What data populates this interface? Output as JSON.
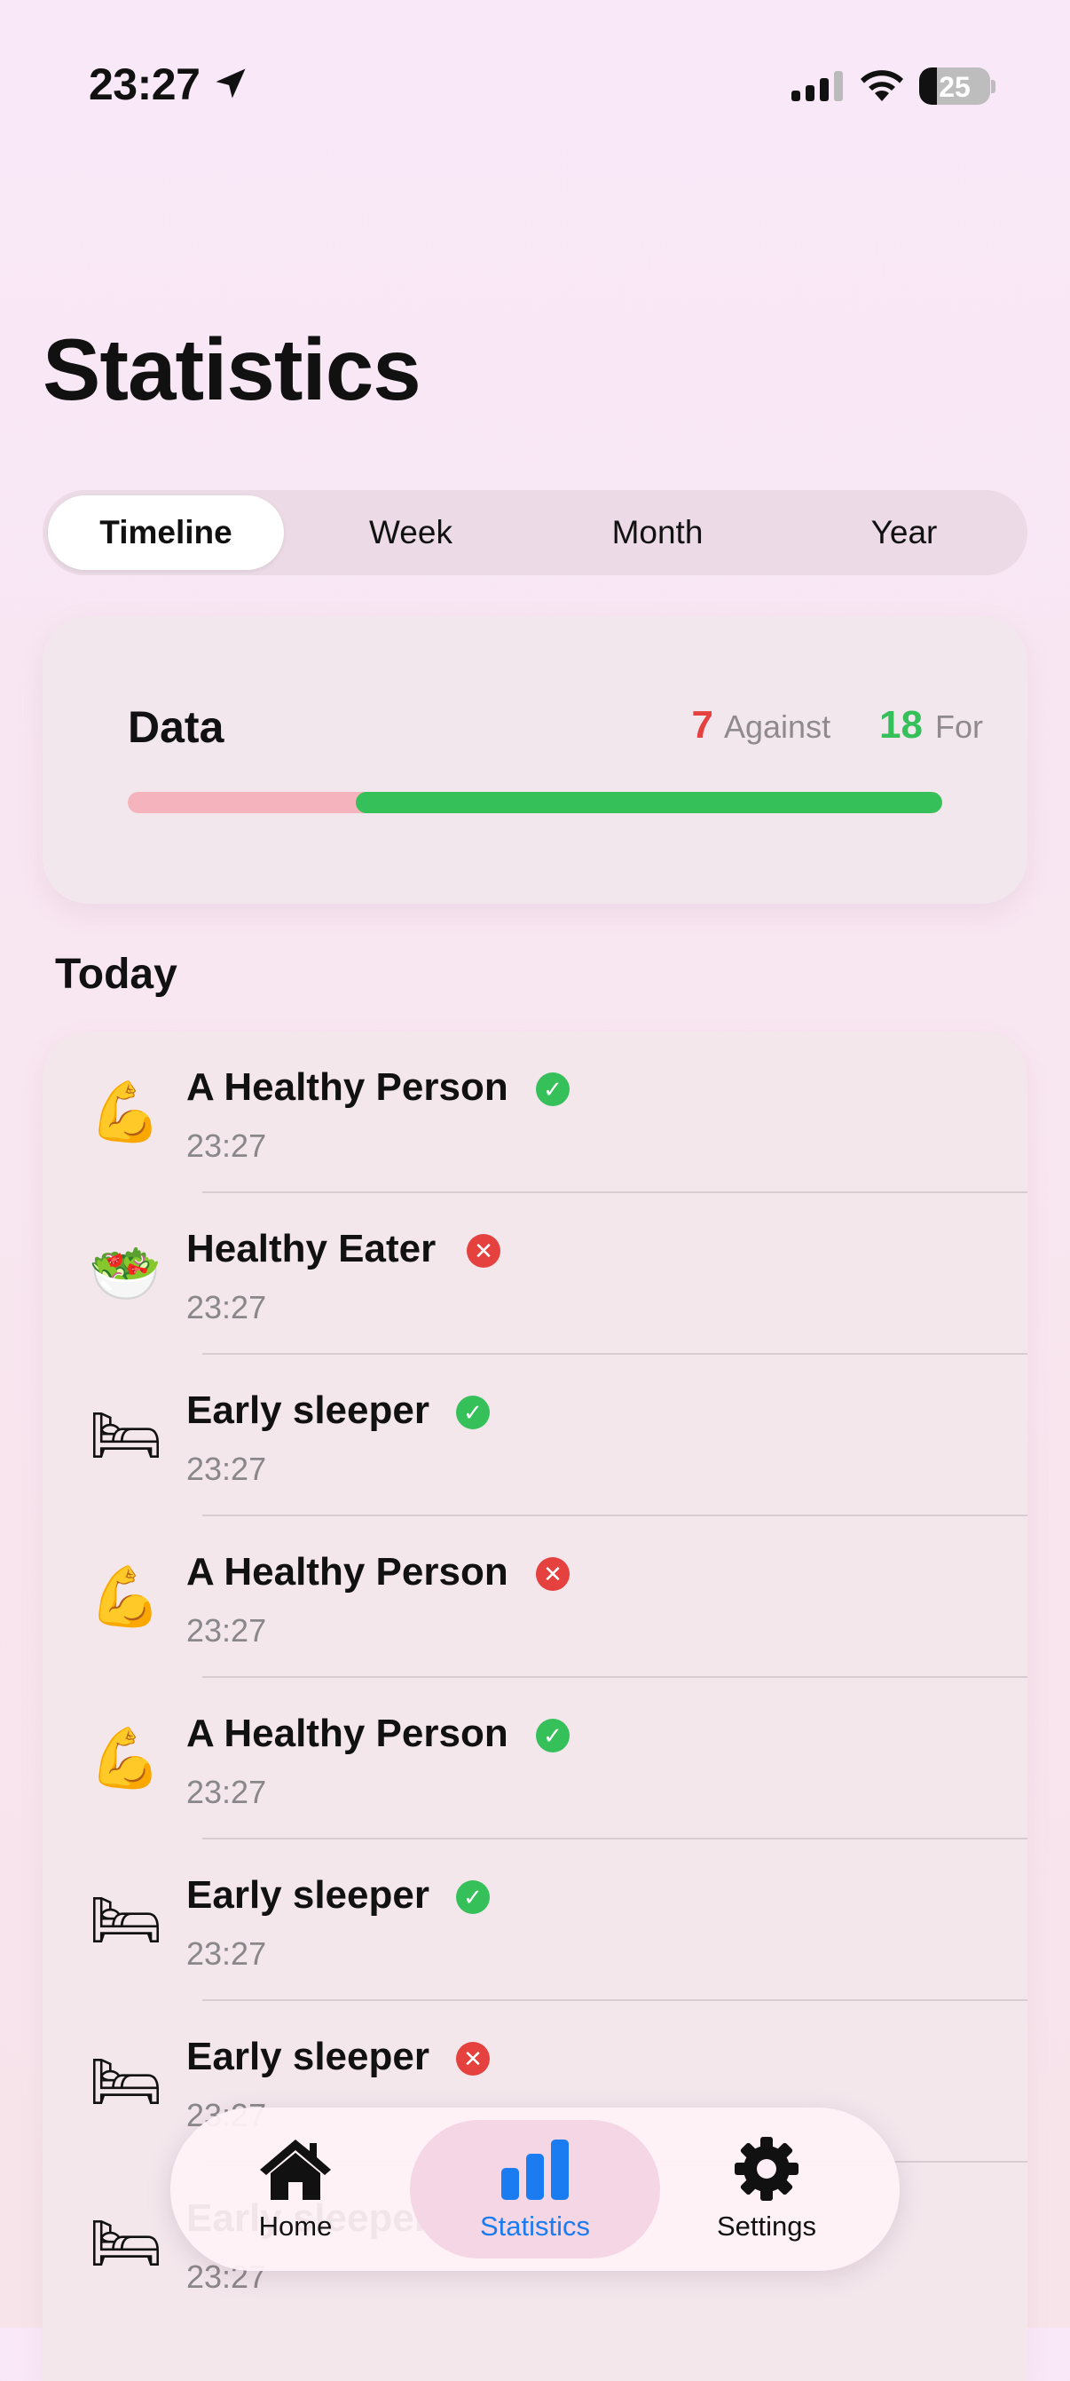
{
  "status_bar": {
    "time": "23:27",
    "battery": "25",
    "battery_level": 0.25
  },
  "page": {
    "title": "Statistics"
  },
  "segments": [
    {
      "label": "Timeline",
      "selected": true
    },
    {
      "label": "Week",
      "selected": false
    },
    {
      "label": "Month",
      "selected": false
    },
    {
      "label": "Year",
      "selected": false
    }
  ],
  "summary": {
    "title": "Data",
    "against_count": "7",
    "against_label": "Against",
    "for_count": "18",
    "for_label": "For",
    "for_fraction": 0.72,
    "colors": {
      "against": "#e5413e",
      "for": "#35c05a"
    }
  },
  "section": {
    "title": "Today"
  },
  "entries": [
    {
      "icon": "flexed-biceps-icon",
      "emoji": "💪",
      "name": "A Healthy Person",
      "status": "success",
      "time": "23:27"
    },
    {
      "icon": "salad-icon",
      "emoji": "🥗",
      "name": "Healthy Eater",
      "status": "fail",
      "time": "23:27"
    },
    {
      "icon": "bed-icon",
      "emoji": "🛏",
      "name": "Early sleeper",
      "status": "success",
      "time": "23:27"
    },
    {
      "icon": "flexed-biceps-icon",
      "emoji": "💪",
      "name": "A Healthy Person",
      "status": "fail",
      "time": "23:27"
    },
    {
      "icon": "flexed-biceps-icon",
      "emoji": "💪",
      "name": "A Healthy Person",
      "status": "success",
      "time": "23:27"
    },
    {
      "icon": "bed-icon",
      "emoji": "🛏",
      "name": "Early sleeper",
      "status": "success",
      "time": "23:27"
    },
    {
      "icon": "bed-icon",
      "emoji": "🛏",
      "name": "Early sleeper",
      "status": "fail",
      "time": "23:27"
    },
    {
      "icon": "bed-icon",
      "emoji": "🛏",
      "name": "Early sleeper",
      "status": "success",
      "time": "23:27"
    }
  ],
  "tab_bar": {
    "home": {
      "label": "Home",
      "icon": "house-icon"
    },
    "statistics": {
      "label": "Statistics",
      "icon": "bar-chart-icon",
      "active": true
    },
    "settings": {
      "label": "Settings",
      "icon": "gear-icon"
    },
    "active_color": "#1a7cf0"
  }
}
